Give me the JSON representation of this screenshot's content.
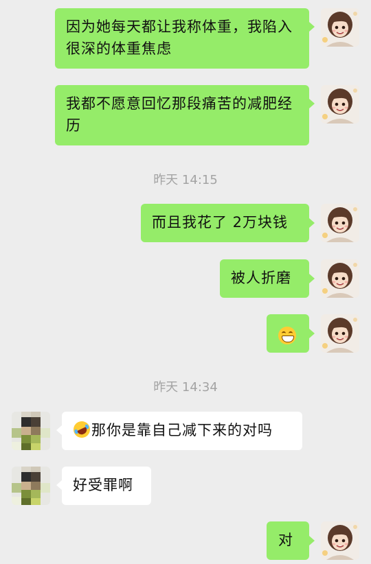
{
  "messages": [
    {
      "sender": "me",
      "text": "因为她每天都让我称体重，我陷入很深的体重焦虑"
    },
    {
      "sender": "me",
      "text": "我都不愿意回忆那段痛苦的减肥经历"
    },
    {
      "sender": "me",
      "text": "而且我花了 2万块钱"
    },
    {
      "sender": "me",
      "text": "被人折磨"
    },
    {
      "sender": "me",
      "emoji": "grinning-face-emoji"
    },
    {
      "sender": "other",
      "emoji": "rolling-laughing-emoji",
      "text": "那你是靠自己减下来的对吗"
    },
    {
      "sender": "other",
      "text": "好受罪啊"
    },
    {
      "sender": "me",
      "text": "对"
    }
  ],
  "timestamps": [
    "昨天 14:15",
    "昨天 14:34"
  ],
  "colors": {
    "background": "#ededed",
    "my_bubble": "#95ec69",
    "other_bubble": "#ffffff",
    "timestamp": "#a3a3a3"
  }
}
